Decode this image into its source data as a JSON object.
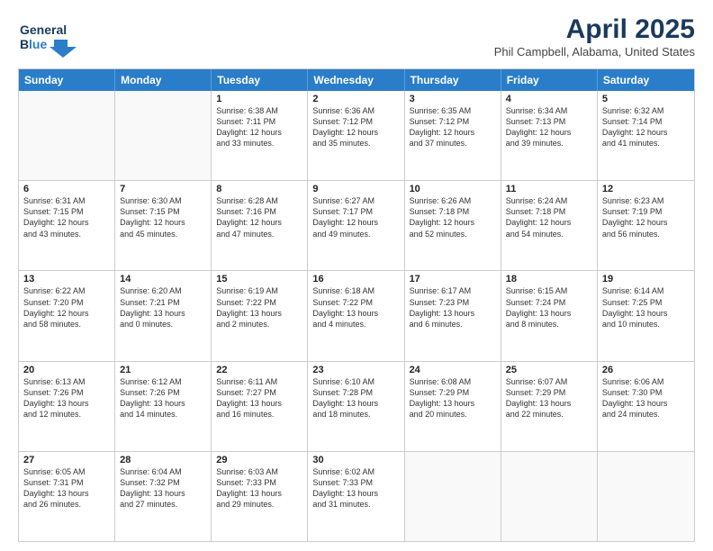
{
  "header": {
    "logo_line1": "General",
    "logo_line2": "Blue",
    "title": "April 2025",
    "subtitle": "Phil Campbell, Alabama, United States"
  },
  "days_of_week": [
    "Sunday",
    "Monday",
    "Tuesday",
    "Wednesday",
    "Thursday",
    "Friday",
    "Saturday"
  ],
  "weeks": [
    [
      {
        "day": "",
        "info": ""
      },
      {
        "day": "",
        "info": ""
      },
      {
        "day": "1",
        "info": "Sunrise: 6:38 AM\nSunset: 7:11 PM\nDaylight: 12 hours\nand 33 minutes."
      },
      {
        "day": "2",
        "info": "Sunrise: 6:36 AM\nSunset: 7:12 PM\nDaylight: 12 hours\nand 35 minutes."
      },
      {
        "day": "3",
        "info": "Sunrise: 6:35 AM\nSunset: 7:12 PM\nDaylight: 12 hours\nand 37 minutes."
      },
      {
        "day": "4",
        "info": "Sunrise: 6:34 AM\nSunset: 7:13 PM\nDaylight: 12 hours\nand 39 minutes."
      },
      {
        "day": "5",
        "info": "Sunrise: 6:32 AM\nSunset: 7:14 PM\nDaylight: 12 hours\nand 41 minutes."
      }
    ],
    [
      {
        "day": "6",
        "info": "Sunrise: 6:31 AM\nSunset: 7:15 PM\nDaylight: 12 hours\nand 43 minutes."
      },
      {
        "day": "7",
        "info": "Sunrise: 6:30 AM\nSunset: 7:15 PM\nDaylight: 12 hours\nand 45 minutes."
      },
      {
        "day": "8",
        "info": "Sunrise: 6:28 AM\nSunset: 7:16 PM\nDaylight: 12 hours\nand 47 minutes."
      },
      {
        "day": "9",
        "info": "Sunrise: 6:27 AM\nSunset: 7:17 PM\nDaylight: 12 hours\nand 49 minutes."
      },
      {
        "day": "10",
        "info": "Sunrise: 6:26 AM\nSunset: 7:18 PM\nDaylight: 12 hours\nand 52 minutes."
      },
      {
        "day": "11",
        "info": "Sunrise: 6:24 AM\nSunset: 7:18 PM\nDaylight: 12 hours\nand 54 minutes."
      },
      {
        "day": "12",
        "info": "Sunrise: 6:23 AM\nSunset: 7:19 PM\nDaylight: 12 hours\nand 56 minutes."
      }
    ],
    [
      {
        "day": "13",
        "info": "Sunrise: 6:22 AM\nSunset: 7:20 PM\nDaylight: 12 hours\nand 58 minutes."
      },
      {
        "day": "14",
        "info": "Sunrise: 6:20 AM\nSunset: 7:21 PM\nDaylight: 13 hours\nand 0 minutes."
      },
      {
        "day": "15",
        "info": "Sunrise: 6:19 AM\nSunset: 7:22 PM\nDaylight: 13 hours\nand 2 minutes."
      },
      {
        "day": "16",
        "info": "Sunrise: 6:18 AM\nSunset: 7:22 PM\nDaylight: 13 hours\nand 4 minutes."
      },
      {
        "day": "17",
        "info": "Sunrise: 6:17 AM\nSunset: 7:23 PM\nDaylight: 13 hours\nand 6 minutes."
      },
      {
        "day": "18",
        "info": "Sunrise: 6:15 AM\nSunset: 7:24 PM\nDaylight: 13 hours\nand 8 minutes."
      },
      {
        "day": "19",
        "info": "Sunrise: 6:14 AM\nSunset: 7:25 PM\nDaylight: 13 hours\nand 10 minutes."
      }
    ],
    [
      {
        "day": "20",
        "info": "Sunrise: 6:13 AM\nSunset: 7:26 PM\nDaylight: 13 hours\nand 12 minutes."
      },
      {
        "day": "21",
        "info": "Sunrise: 6:12 AM\nSunset: 7:26 PM\nDaylight: 13 hours\nand 14 minutes."
      },
      {
        "day": "22",
        "info": "Sunrise: 6:11 AM\nSunset: 7:27 PM\nDaylight: 13 hours\nand 16 minutes."
      },
      {
        "day": "23",
        "info": "Sunrise: 6:10 AM\nSunset: 7:28 PM\nDaylight: 13 hours\nand 18 minutes."
      },
      {
        "day": "24",
        "info": "Sunrise: 6:08 AM\nSunset: 7:29 PM\nDaylight: 13 hours\nand 20 minutes."
      },
      {
        "day": "25",
        "info": "Sunrise: 6:07 AM\nSunset: 7:29 PM\nDaylight: 13 hours\nand 22 minutes."
      },
      {
        "day": "26",
        "info": "Sunrise: 6:06 AM\nSunset: 7:30 PM\nDaylight: 13 hours\nand 24 minutes."
      }
    ],
    [
      {
        "day": "27",
        "info": "Sunrise: 6:05 AM\nSunset: 7:31 PM\nDaylight: 13 hours\nand 26 minutes."
      },
      {
        "day": "28",
        "info": "Sunrise: 6:04 AM\nSunset: 7:32 PM\nDaylight: 13 hours\nand 27 minutes."
      },
      {
        "day": "29",
        "info": "Sunrise: 6:03 AM\nSunset: 7:33 PM\nDaylight: 13 hours\nand 29 minutes."
      },
      {
        "day": "30",
        "info": "Sunrise: 6:02 AM\nSunset: 7:33 PM\nDaylight: 13 hours\nand 31 minutes."
      },
      {
        "day": "",
        "info": ""
      },
      {
        "day": "",
        "info": ""
      },
      {
        "day": "",
        "info": ""
      }
    ]
  ]
}
